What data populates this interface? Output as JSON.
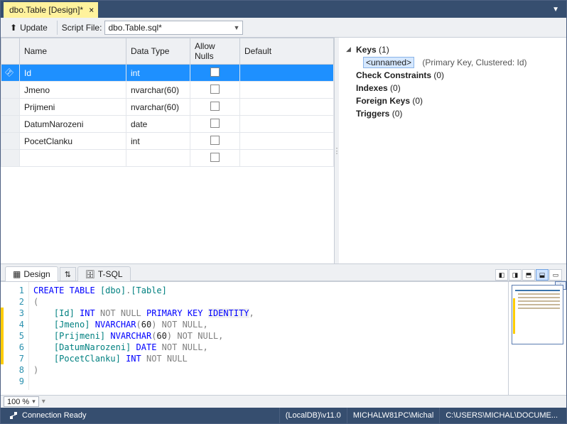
{
  "tab": {
    "title": "dbo.Table [Design]*"
  },
  "toolbar": {
    "update_label": "Update",
    "script_label": "Script File:",
    "script_value": "dbo.Table.sql*"
  },
  "grid": {
    "headers": {
      "name": "Name",
      "datatype": "Data Type",
      "allownulls": "Allow Nulls",
      "default": "Default"
    },
    "rows": [
      {
        "name": "Id",
        "type": "int",
        "nulls": false,
        "key": true
      },
      {
        "name": "Jmeno",
        "type": "nvarchar(60)",
        "nulls": false,
        "key": false
      },
      {
        "name": "Prijmeni",
        "type": "nvarchar(60)",
        "nulls": false,
        "key": false
      },
      {
        "name": "DatumNarozeni",
        "type": "date",
        "nulls": false,
        "key": false
      },
      {
        "name": "PocetClanku",
        "type": "int",
        "nulls": false,
        "key": false
      }
    ]
  },
  "props": {
    "keys": {
      "label": "Keys",
      "count": "(1)",
      "unnamed": "<unnamed>",
      "detail": "(Primary Key, Clustered: Id)"
    },
    "check": {
      "label": "Check Constraints",
      "count": "(0)"
    },
    "indexes": {
      "label": "Indexes",
      "count": "(0)"
    },
    "fkeys": {
      "label": "Foreign Keys",
      "count": "(0)"
    },
    "triggers": {
      "label": "Triggers",
      "count": "(0)"
    }
  },
  "midtabs": {
    "design": "Design",
    "tsql": "T-SQL"
  },
  "sql": {
    "lines": [
      "CREATE TABLE [dbo].[Table]",
      "(",
      "    [Id] INT NOT NULL PRIMARY KEY IDENTITY,",
      "    [Jmeno] NVARCHAR(60) NOT NULL,",
      "    [Prijmeni] NVARCHAR(60) NOT NULL,",
      "    [DatumNarozeni] DATE NOT NULL,",
      "    [PocetClanku] INT NOT NULL",
      ")",
      ""
    ]
  },
  "zoom": {
    "value": "100 %"
  },
  "status": {
    "conn": "Connection Ready",
    "server": "(LocalDB)\\v11.0",
    "user": "MICHALW81PC\\Michal",
    "path": "C:\\USERS\\MICHAL\\DOCUME..."
  }
}
